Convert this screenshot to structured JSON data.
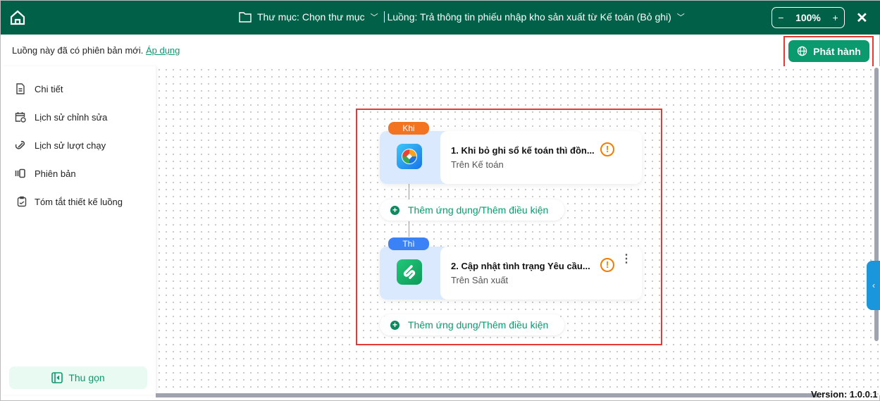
{
  "header": {
    "folder_label": "Thư mục: Chọn thư mục",
    "flow_label": "Luồng: Trả thông tin phiếu nhập kho sản xuất từ Kế toán (Bỏ ghi)",
    "zoom": "100%",
    "zoom_minus": "−",
    "zoom_plus": "+",
    "close": "✕"
  },
  "notice": {
    "text": "Luồng này đã có phiên bản mới.",
    "link": "Áp dụng"
  },
  "publish_label": "Phát hành",
  "sidebar": {
    "items": [
      {
        "label": "Chi tiết"
      },
      {
        "label": "Lịch sử chỉnh sửa"
      },
      {
        "label": "Lịch sử lượt chạy"
      },
      {
        "label": "Phiên bản"
      },
      {
        "label": "Tóm tắt thiết kế luồng"
      }
    ],
    "collapse_label": "Thu gọn"
  },
  "flow": {
    "steps": [
      {
        "tag": "Khi",
        "tag_color": "#f47320",
        "title": "1.  Khi bỏ ghi sổ kế toán thì đồn...",
        "subtitle": "Trên Kế toán",
        "warning": "!"
      },
      {
        "tag": "Thì",
        "tag_color": "#3b82f6",
        "title": "2.  Cập nhật tình trạng Yêu cầu...",
        "subtitle": "Trên Sản xuất",
        "warning": "!"
      }
    ],
    "add_label": "Thêm ứng dụng/Thêm điều kiện"
  },
  "version": "Version: 1.0.0.1",
  "colors": {
    "header": "#006148",
    "accent": "#0a9a6e"
  }
}
